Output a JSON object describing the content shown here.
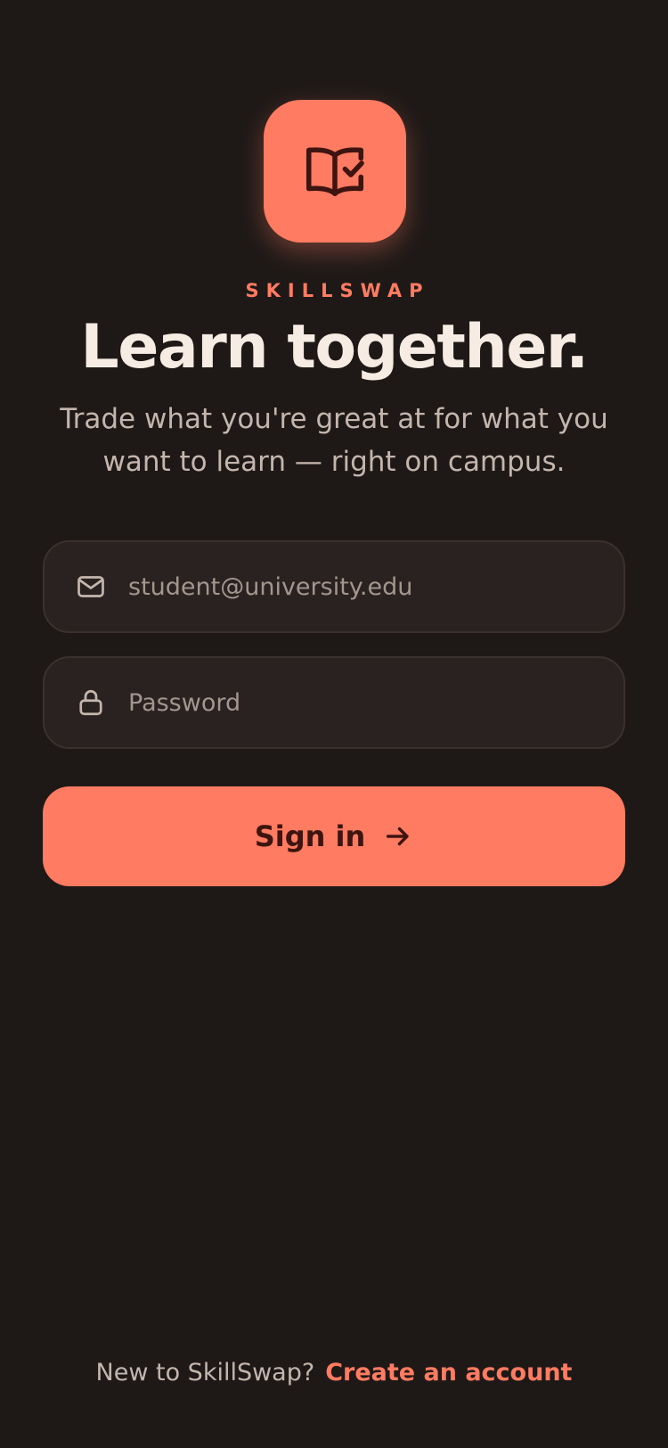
{
  "brand": {
    "name": "SKILLSWAP",
    "logo_icon": "book-check-icon",
    "accent_color": "#ff7b61"
  },
  "hero": {
    "title": "Learn together.",
    "subtitle": "Trade what you're great at for what you want to learn — right on campus."
  },
  "form": {
    "email": {
      "icon": "mail-icon",
      "value": "",
      "placeholder": "student@university.edu"
    },
    "password": {
      "icon": "lock-icon",
      "value": "",
      "placeholder": "Password"
    },
    "submit": {
      "label": "Sign in",
      "icon": "arrow-right-icon"
    }
  },
  "footer": {
    "prompt": "New to SkillSwap?",
    "link": "Create an account"
  },
  "colors": {
    "background": "#1e1917",
    "field_background": "#2a2220",
    "field_border": "#3a312e",
    "button_text": "#3e1410",
    "muted_text": "#c4b6ad"
  }
}
